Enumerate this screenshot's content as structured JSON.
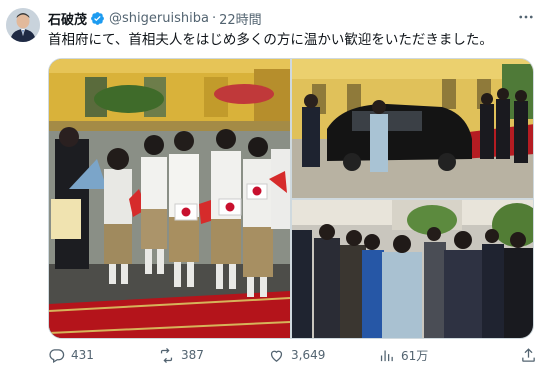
{
  "post": {
    "author_name": "石破茂",
    "handle": "@shigeruishiba",
    "separator": "·",
    "time": "22時間",
    "more_icon": "more-horizontal-icon",
    "verified_color": "#1d9bf0",
    "text": "首相府にて、首相夫人をはじめ多くの方に温かい歓迎をいただきました。"
  },
  "media": {
    "photos": [
      {
        "name": "photo-children-welcome",
        "description_hidden": true
      },
      {
        "name": "photo-motorcade-arrival"
      },
      {
        "name": "photo-greeting-line"
      }
    ]
  },
  "actions": {
    "replies": "431",
    "reposts": "387",
    "likes": "3,649",
    "views": "61万"
  },
  "colors": {
    "text": "#0f1419",
    "muted": "#536471",
    "border": "#cfd9de",
    "accent": "#1d9bf0"
  }
}
